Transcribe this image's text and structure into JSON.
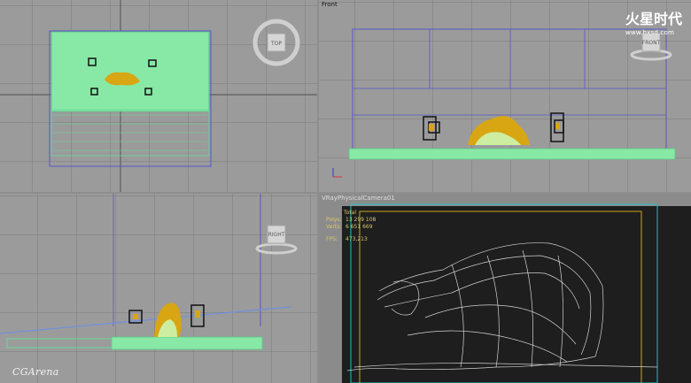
{
  "watermark": "CGArena",
  "brand": {
    "logo": "火星时代",
    "url": "www.hxsd.com"
  },
  "viewports": {
    "top": {
      "cube_label": "TOP"
    },
    "front": {
      "label": "Front",
      "cube_label": "FRONT"
    },
    "left": {
      "cube_label": "RIGHT"
    },
    "camera": {
      "label": "VRayPhysicalCamera01",
      "stats_header": "Total",
      "stats": [
        {
          "k": "Polys:",
          "v": "13 299 108"
        },
        {
          "k": "Verts:",
          "v": "6 651 669"
        }
      ],
      "fps_label": "FPS:",
      "fps_value": "473,213"
    }
  },
  "colors": {
    "active_border": "#e6d400",
    "fur_green": "#7fe8a0",
    "model_gold": "#d8a613",
    "selection_blue": "#5a56c9",
    "camera_bg": "#1a1a1a"
  }
}
